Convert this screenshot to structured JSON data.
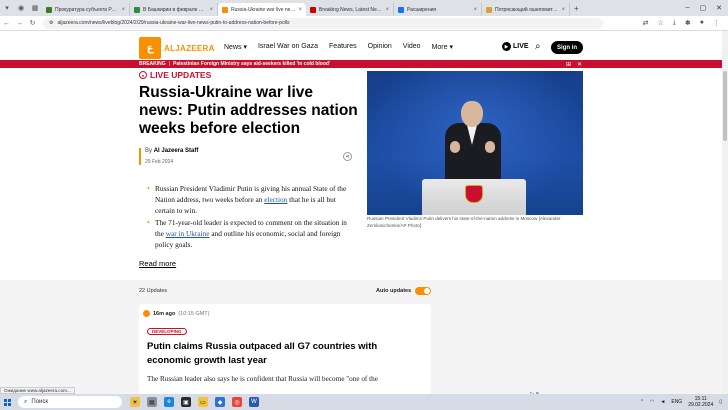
{
  "browser": {
    "tabs": [
      {
        "title": "Прокуратура субъекта России",
        "color": "#3b7d23",
        "active": false
      },
      {
        "title": "В Башкирии в феврале погиб...",
        "color": "#2e8b3a",
        "active": false
      },
      {
        "title": "Russia-Ukraine war live news: P...",
        "color": "#fa9000",
        "active": true
      },
      {
        "title": "Breaking News, Latest News and...",
        "color": "#cc0000",
        "active": false
      },
      {
        "title": "Расширения",
        "color": "#1a73e8",
        "active": false
      },
      {
        "title": "Потрясающий ошеломит в мы...",
        "color": "#e0a030",
        "active": false
      }
    ],
    "url": "aljazeera.com/news/liveblog/2024/2/29/russia-ukraine-war-live-news-putin-to-address-nation-before-polls"
  },
  "site": {
    "logo_text": "ALJAZEERA",
    "nav": [
      "News",
      "Israel War on Gaza",
      "Features",
      "Opinion",
      "Video",
      "More"
    ],
    "live_label": "LIVE",
    "signin_label": "Sign in"
  },
  "breaking": {
    "label": "BREAKING",
    "separator": "|",
    "message": "Palestinian Foreign Ministry says aid-seekers killed 'in cold blood'"
  },
  "article": {
    "live_updates": "LIVE UPDATES",
    "headline": "Russia-Ukraine war live news: Putin addresses nation weeks before election",
    "by_prefix": "By",
    "author": "Al Jazeera Staff",
    "date": "29 Feb 2024",
    "bullet1_a": "Russian President Vladimir Putin is giving his annual State of the Nation address, two weeks before an ",
    "bullet1_link": "election",
    "bullet1_b": " that he is all but certain to win.",
    "bullet2_a": "The 71-year-old leader is expected to comment on the situation in the ",
    "bullet2_link": "war in Ukraine",
    "bullet2_b": " and outline his economic, social and foreign policy goals.",
    "read_more": "Read more",
    "caption": "Russian President Vladimir Putin delivers his state-of-the-nation address in Moscow [Alexander Zemlianichenko/AP Photo]"
  },
  "feed": {
    "count": "22 Updates",
    "auto_updates": "Auto updates",
    "auto_on": true,
    "card": {
      "ago": "16m ago",
      "clock": "(10:15 GMT)",
      "badge": "DEVELOPING",
      "title": "Putin claims Russia outpaced all G7 countries with economic growth last year",
      "body": "The Russian leader also says he is confident that Russia will become \"one of the"
    }
  },
  "status_text": "Ожидание www.aljazeera.com...",
  "taskbar": {
    "search_label": "Поиск",
    "lang": "ENG",
    "time": "15:11",
    "date": "29.02.2024"
  },
  "colors": {
    "brand": "#fa9000",
    "breaking": "#c8102e",
    "link": "#1a55b8"
  }
}
